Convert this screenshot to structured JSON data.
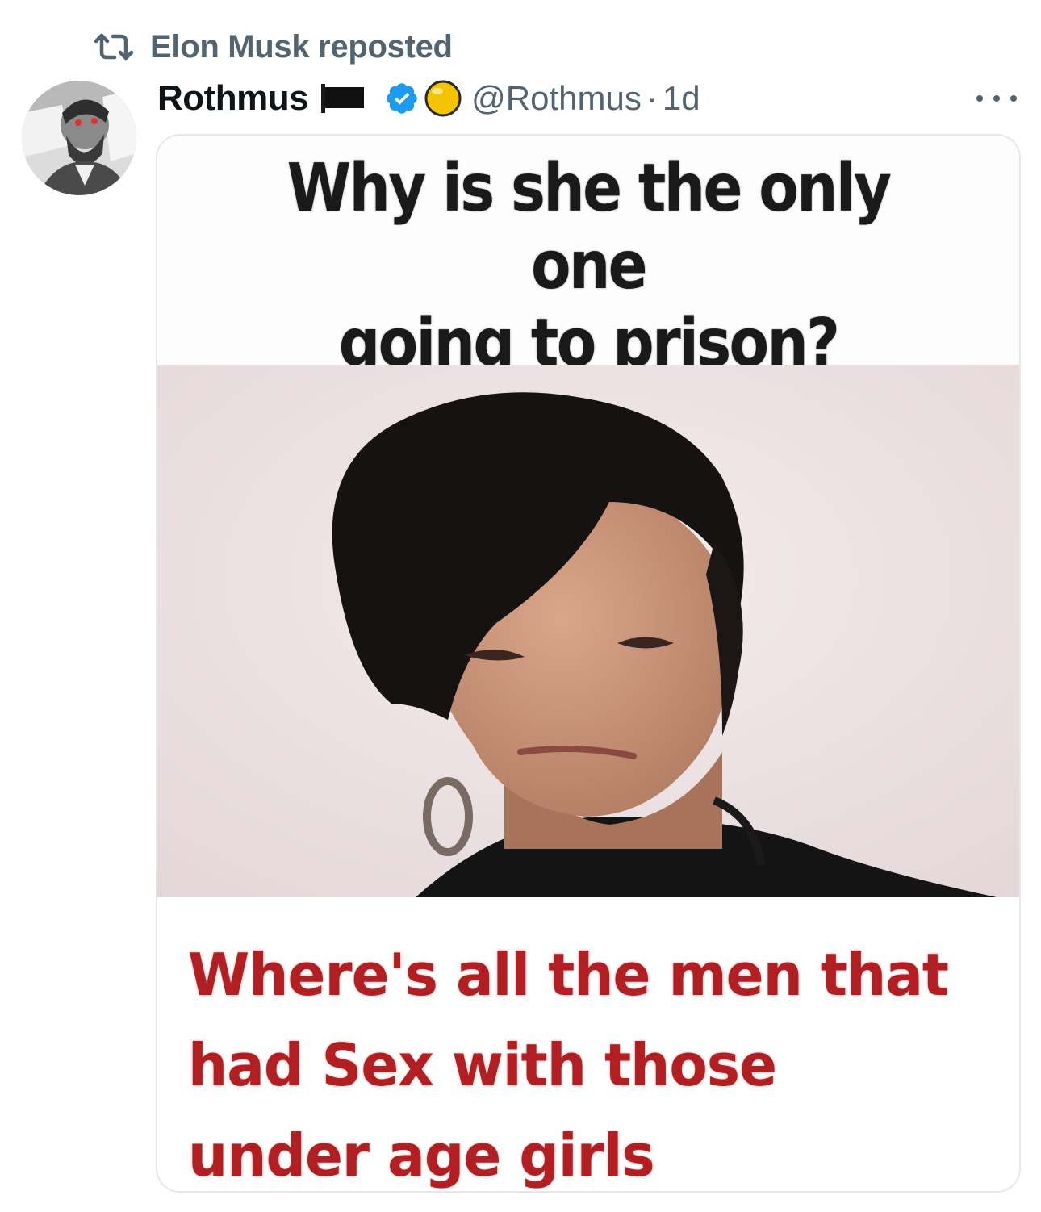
{
  "repost": {
    "text": "Elon Musk reposted",
    "icon": "repost-icon"
  },
  "author": {
    "display_name": "Rothmus",
    "name_emoji": [
      "black-flag-icon",
      "yellow-circle-icon"
    ],
    "verified": true,
    "verified_color": "#1d9bf0",
    "handle": "@Rothmus",
    "separator": "·",
    "time": "1d",
    "avatar_icon": "avatar"
  },
  "more_icon": "more-options-icon",
  "meme": {
    "top_text": [
      "Why is she the only one",
      "going to prison?"
    ],
    "bottom_text": [
      "Where's all the men that",
      "had Sex with those",
      "under age girls"
    ],
    "bottom_text_color": "#b21f23",
    "photo_background": "#ebdfe1"
  },
  "colors": {
    "primary_text": "#0f1419",
    "secondary_text": "#536471",
    "border": "#e4e8eb"
  }
}
